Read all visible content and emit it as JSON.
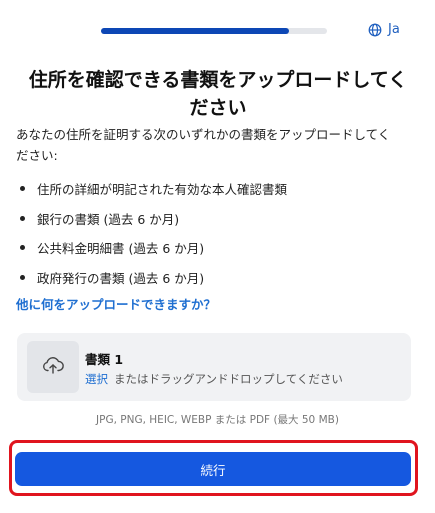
{
  "progress": {
    "value_percent": 83
  },
  "language": {
    "icon": "globe-icon",
    "label": "Ja"
  },
  "header": {
    "title_line1": "住所を確認できる書類をアップロードしてく",
    "title_line2": "ださい"
  },
  "intro": {
    "line1": "あなたの住所を証明する次のいずれかの書類をアップロードしてく",
    "line2": "ださい:"
  },
  "documents": [
    "住所の詳細が明記された有効な本人確認書類",
    "銀行の書類 (過去 6 か月)",
    "公共料金明細書 (過去 6 か月)",
    "政府発行の書類 (過去 6 か月)"
  ],
  "help_link": "他に何をアップロードできますか？",
  "upload": {
    "icon": "upload-cloud-icon",
    "name": "書類 1",
    "select_label": "選択",
    "drag_text": "またはドラッグアンドドロップしてください"
  },
  "formats_text": "JPG, PNG, HEIC, WEBP または PDF (最大 50 MB)",
  "continue_label": "続行",
  "colors": {
    "accent": "#1558e0",
    "progress": "#0d47b5",
    "link": "#1f6fd1",
    "highlight": "#e0141e"
  }
}
